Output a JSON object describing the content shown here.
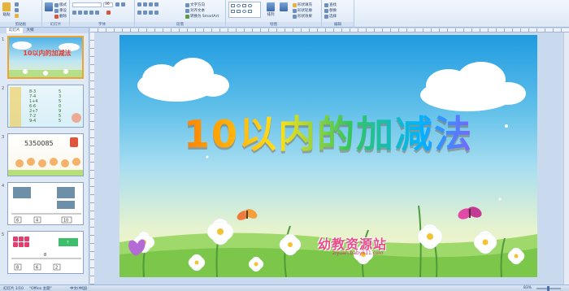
{
  "ribbon": {
    "groups": [
      {
        "label": "剪贴板"
      },
      {
        "label": "幻灯片"
      },
      {
        "label": "字体"
      },
      {
        "label": "段落"
      },
      {
        "label": "绘图"
      },
      {
        "label": "编辑"
      }
    ],
    "font_size_value": "36",
    "paste_label": "粘贴",
    "new_slide_label": "新建幻灯片",
    "layout_label": "版式",
    "reset_label": "重设",
    "delete_label": "删除",
    "text_direction_label": "文字方向",
    "align_text_label": "对齐文本",
    "smartart_label": "转换为 SmartArt",
    "arrange_label": "排列",
    "quick_styles_label": "快速样式",
    "shape_fill_label": "形状填充",
    "shape_outline_label": "形状轮廓",
    "shape_effects_label": "形状效果",
    "find_label": "查找",
    "replace_label": "替换",
    "select_label": "选择"
  },
  "thumbnails": {
    "tabs": [
      "幻灯片",
      "大纲"
    ],
    "items": [
      {
        "number": "1",
        "title": "10以内的加减法"
      },
      {
        "number": "2",
        "equations": [
          "8-3",
          "7-4",
          "1+4",
          "6-6",
          "2+7",
          "7-2",
          "9-4"
        ],
        "answers": [
          "5",
          "3",
          "5",
          "0",
          "9",
          "5",
          "5"
        ]
      },
      {
        "number": "3",
        "number_text": "5350085"
      },
      {
        "number": "4",
        "row": [
          "6",
          "4",
          "10"
        ]
      },
      {
        "number": "5",
        "top": "8",
        "row": [
          "8",
          "6",
          "2"
        ],
        "box_value": "?"
      }
    ]
  },
  "slide": {
    "title": "10以内的加减法",
    "logo_text": "幼教资源站",
    "logo_url": "ziyuan.baby611.com"
  },
  "status_bar": {
    "slide_info": "幻灯片 1/10",
    "theme": "\"Office 主题\"",
    "language": "中文(中国)",
    "zoom": "83%"
  },
  "colors": {
    "ribbon_bg": "#dde8f6",
    "panel_bg": "#dfe8f5",
    "selection": "#f0a430",
    "sky_top": "#1f9be0",
    "sky_bottom": "#f6f2c0"
  }
}
